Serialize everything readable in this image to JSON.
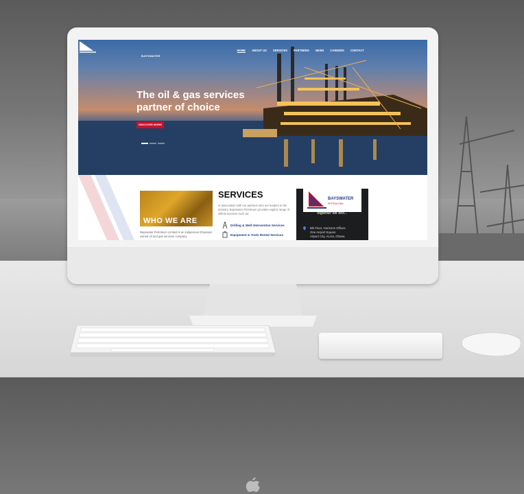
{
  "nav": {
    "logo_text": "BAYSWATER",
    "items": [
      "HOME",
      "ABOUT US",
      "SERVICES",
      "PARTNERS",
      "NEWS",
      "CAREERS",
      "CONTACT"
    ]
  },
  "hero": {
    "title": "The oil & gas services partner of choice",
    "button": "DISCOVER MORE"
  },
  "who": {
    "title": "WHO WE ARE",
    "text": "Bayswater Petroleum Limited is an indigenous Ghanaian owned oil and gas services company"
  },
  "services": {
    "title": "SERVICES",
    "description": "In association with our partners who are leaders in the industry, Bayswater Petroleum provides explicit range of oilfield services such as;",
    "items": [
      "Drilling & Well Intervention Services",
      "Equipment & Tools Rental Services"
    ]
  },
  "card": {
    "brand": "BAYSWATER",
    "brand_sub": "PETROLEUM",
    "tagline": "together we drill...",
    "address": [
      "8th Floor, Horizons Offices",
      "One Airport Square",
      "Airport City, Accra, Ghana"
    ]
  },
  "colors": {
    "accent": "#c8102e",
    "link": "#1f3c88",
    "card_bg": "#1c1d1f"
  }
}
